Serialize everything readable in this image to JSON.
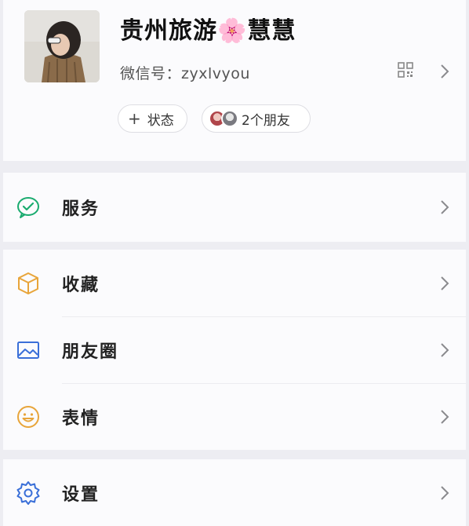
{
  "profile": {
    "name": "贵州旅游🌸慧慧",
    "wechat_id_label": "微信号：",
    "wechat_id": "zyxlvyou",
    "qr_icon": "qr-code-icon",
    "status_button": "状态",
    "friends_label": "2个朋友"
  },
  "menu": {
    "service": "服务",
    "favorites": "收藏",
    "moments": "朋友圈",
    "stickers": "表情",
    "settings": "设置"
  },
  "colors": {
    "background": "#ededf2",
    "card": "#fbfbfd",
    "service_icon": "#1aab6f",
    "favorites_icon": "#e8a53a",
    "moments_icon": "#3a6fd8",
    "stickers_icon": "#e8a53a",
    "settings_icon": "#3a6fd8"
  }
}
